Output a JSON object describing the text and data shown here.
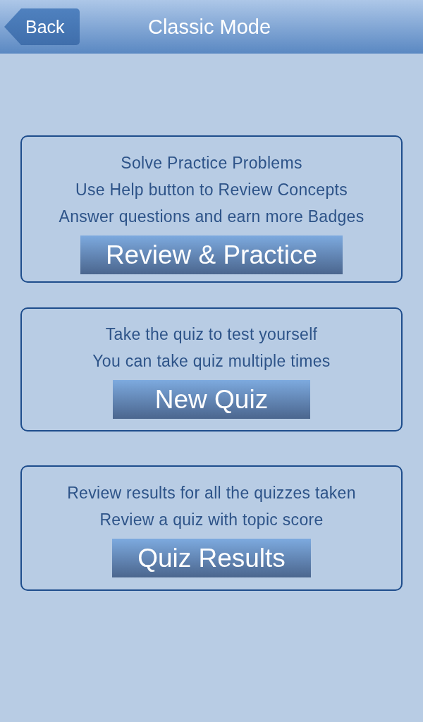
{
  "header": {
    "back_button": "Back",
    "title": "Classic Mode"
  },
  "sections": [
    {
      "lines": [
        "Solve Practice Problems",
        "Use Help button to Review Concepts",
        "Answer questions and earn more Badges"
      ],
      "button": "Review & Practice"
    },
    {
      "lines": [
        "Take the quiz to test yourself",
        "You can take quiz multiple times"
      ],
      "button": "New Quiz"
    },
    {
      "lines": [
        "Review results for all the quizzes taken",
        "Review a quiz with topic score"
      ],
      "button": "Quiz Results"
    }
  ]
}
